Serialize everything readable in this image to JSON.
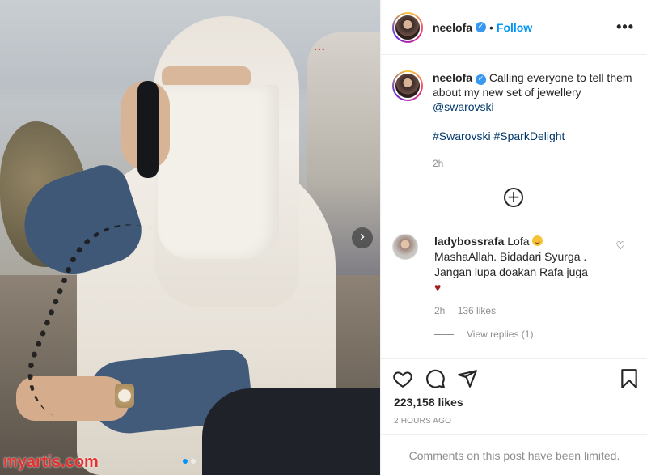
{
  "post": {
    "author": "neelofa",
    "follow_label": "Follow",
    "separator": "•",
    "more_label": "•••",
    "caption_text": "Calling everyone to tell them about my new set of jewellery",
    "mention": "@swarovski",
    "hashtags": [
      "#Swarovski",
      "#SparkDelight"
    ],
    "time": "2h",
    "likes": "223,158 likes",
    "posted_ago": "2 HOURS AGO",
    "comments_limited": "Comments on this post have been limited."
  },
  "comment": {
    "author": "ladybossrafa",
    "line1": "Lofa",
    "line2": "MashaAllah. Bidadari Syurga . Jangan lupa doakan Rafa juga",
    "heart": "♥",
    "time": "2h",
    "likes": "136 likes",
    "like_icon": "♡",
    "view_replies": "View replies (1)"
  },
  "carousel": {
    "next_icon": "›",
    "total": 2,
    "active": 1
  },
  "photo": {
    "watermark": "myartis.com",
    "top_dots": "..."
  },
  "icons": {
    "load_more": "⊕",
    "verified": "✓"
  },
  "colors": {
    "link": "#0095f6",
    "mention": "#00376b",
    "watermark": "#e63030",
    "verified": "#3897f0"
  }
}
